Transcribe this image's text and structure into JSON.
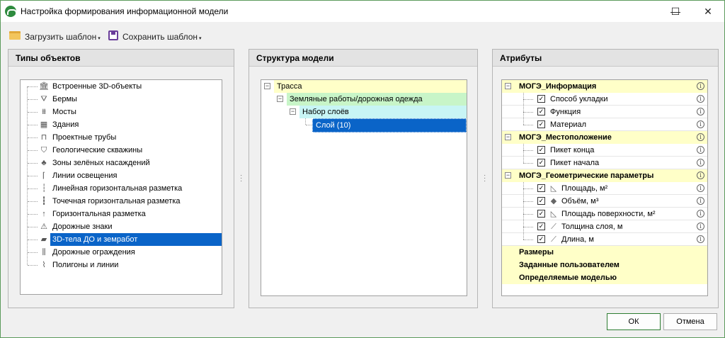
{
  "window": {
    "title": "Настройка формирования информационной модели",
    "minimize": "—",
    "maximize": "☐",
    "close": "✕"
  },
  "toolbar": {
    "load_label": "Загрузить шаблон",
    "save_label": "Сохранить шаблон",
    "caret": "▾"
  },
  "object_types": {
    "header": "Типы объектов",
    "items": [
      {
        "label": "Встроенные 3D-объекты",
        "icon": "column-icon",
        "glyph": "🏛"
      },
      {
        "label": "Бермы",
        "icon": "cone-icon",
        "glyph": "⛛"
      },
      {
        "label": "Мосты",
        "icon": "bridge-icon",
        "glyph": "⩩"
      },
      {
        "label": "Здания",
        "icon": "building-icon",
        "glyph": "▦"
      },
      {
        "label": "Проектные трубы",
        "icon": "pipe-icon",
        "glyph": "⊓"
      },
      {
        "label": "Геологические скважины",
        "icon": "diamond-icon",
        "glyph": "⛉"
      },
      {
        "label": "Зоны зелёных насаждений",
        "icon": "tree-icon",
        "glyph": "♣"
      },
      {
        "label": "Линии освещения",
        "icon": "lamp-icon",
        "glyph": "⌈"
      },
      {
        "label": "Линейная горизонтальная разметка",
        "icon": "road-line-icon",
        "glyph": "┆"
      },
      {
        "label": "Точечная горизонтальная разметка",
        "icon": "road-point-icon",
        "glyph": "┇"
      },
      {
        "label": "Горизонтальная разметка",
        "icon": "road-arrow-icon",
        "glyph": "↑"
      },
      {
        "label": "Дорожные знаки",
        "icon": "road-sign-icon",
        "glyph": "⚠"
      },
      {
        "label": "3D-тела ДО и земработ",
        "icon": "layers-icon",
        "glyph": "▰"
      },
      {
        "label": "Дорожные ограждения",
        "icon": "fence-icon",
        "glyph": "⫼"
      },
      {
        "label": "Полигоны и линии",
        "icon": "polyline-icon",
        "glyph": "⌇"
      }
    ],
    "selected_index": 12
  },
  "model_structure": {
    "header": "Структура модели",
    "nodes": [
      {
        "label": "Трасса",
        "expander": "−",
        "bg": "#ffffc8"
      },
      {
        "label": "Земляные работы/дорожная одежда",
        "expander": "−",
        "bg": "#c8f5c8"
      },
      {
        "label": "Набор слоёв",
        "expander": "−",
        "bg": "#c8f5f5"
      },
      {
        "label": "Слой (10)",
        "expander": "",
        "bg": "#0a64c8"
      }
    ]
  },
  "attributes": {
    "header": "Атрибуты",
    "check": "✓",
    "info": "i",
    "groups": [
      {
        "label": "МОГЭ_Информация",
        "items": [
          {
            "label": "Способ укладки",
            "icon": ""
          },
          {
            "label": "Функция",
            "icon": ""
          },
          {
            "label": "Материал",
            "icon": ""
          }
        ]
      },
      {
        "label": "МОГЭ_Местоположение",
        "items": [
          {
            "label": "Пикет конца",
            "icon": ""
          },
          {
            "label": "Пикет начала",
            "icon": ""
          }
        ]
      },
      {
        "label": "МОГЭ_Геометрические параметры",
        "items": [
          {
            "label": "Площадь, м²",
            "icon": "area-icon",
            "glyph": "◺"
          },
          {
            "label": "Объём, м³",
            "icon": "volume-icon",
            "glyph": "◆"
          },
          {
            "label": "Площадь поверхности, м²",
            "icon": "surface-icon",
            "glyph": "◺"
          },
          {
            "label": "Толщина слоя, м",
            "icon": "thickness-icon",
            "glyph": "⟋"
          },
          {
            "label": "Длина, м",
            "icon": "length-icon",
            "glyph": "⟋"
          }
        ]
      }
    ],
    "extra_groups": [
      "Размеры",
      "Заданные пользователем",
      "Определяемые моделью"
    ]
  },
  "buttons": {
    "ok": "ОК",
    "cancel": "Отмена"
  },
  "colors": {
    "selection": "#0a64c8",
    "attr_group": "#ffffc8",
    "accent": "#2e8b3e"
  }
}
